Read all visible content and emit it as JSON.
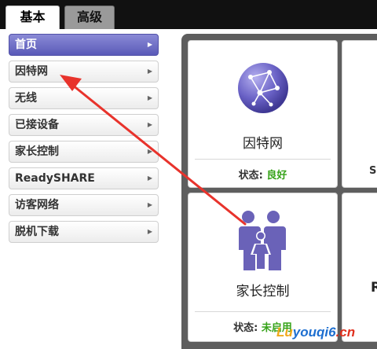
{
  "header": {
    "tabs": [
      {
        "label": "基本",
        "active": true
      },
      {
        "label": "高级",
        "active": false
      }
    ]
  },
  "sidebar": {
    "items": [
      {
        "label": "首页",
        "active": true,
        "icon": "triangle-right-icon"
      },
      {
        "label": "因特网",
        "active": false,
        "icon": "triangle-right-icon"
      },
      {
        "label": "无线",
        "active": false,
        "icon": "triangle-right-icon"
      },
      {
        "label": "已接设备",
        "active": false,
        "icon": "triangle-right-icon"
      },
      {
        "label": "家长控制",
        "active": false,
        "icon": "triangle-right-icon"
      },
      {
        "label": "ReadySHARE",
        "active": false,
        "icon": "triangle-right-icon"
      },
      {
        "label": "访客网络",
        "active": false,
        "icon": "triangle-right-icon"
      },
      {
        "label": "脱机下载",
        "active": false,
        "icon": "triangle-right-icon"
      }
    ]
  },
  "cards": [
    {
      "title": "因特网",
      "status_label": "状态:",
      "status_value": "良好",
      "icon": "globe-network-icon"
    },
    {
      "title": "家长控制",
      "status_label": "状态:",
      "status_value": "未启用",
      "icon": "family-icon"
    }
  ],
  "partial": {
    "right_top_char": "S",
    "right_bottom_char": "R"
  },
  "watermark": {
    "part1": "Lu",
    "part2": "youqi6",
    "part3": ".cn"
  },
  "colors": {
    "active_nav": "#6b6bc4",
    "status_good": "#36a319",
    "annotation_arrow": "#e8332c",
    "family_icon": "#6a62b8"
  }
}
